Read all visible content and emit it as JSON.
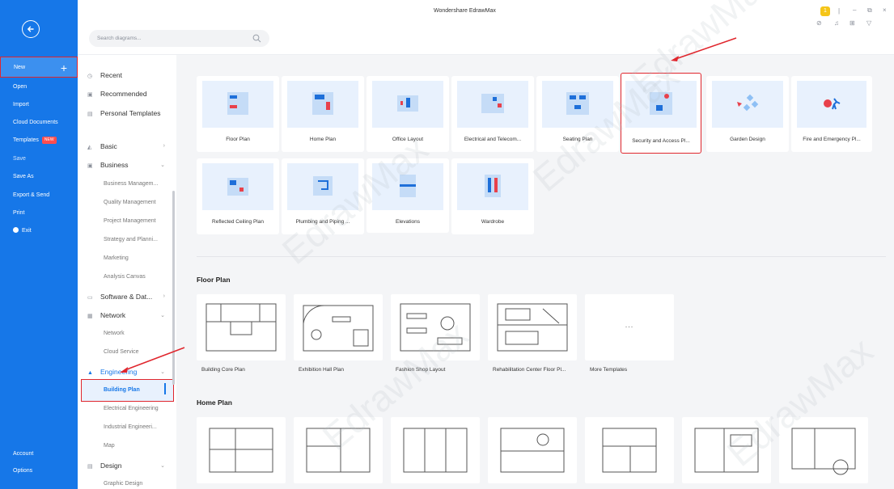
{
  "app": {
    "title": "Wondershare EdrawMax",
    "user_badge": "1"
  },
  "search": {
    "placeholder": "Search diagrams..."
  },
  "leftnav": {
    "new": "New",
    "open": "Open",
    "import": "Import",
    "cloud_documents": "Cloud Documents",
    "templates": "Templates",
    "templates_badge": "NEW",
    "save": "Save",
    "save_as": "Save As",
    "export_send": "Export & Send",
    "print": "Print",
    "exit": "Exit",
    "account": "Account",
    "options": "Options"
  },
  "categories": {
    "recent": "Recent",
    "recommended": "Recommended",
    "personal_templates": "Personal Templates",
    "basic": "Basic",
    "business": "Business",
    "business_subs": [
      "Business Managem...",
      "Quality Management",
      "Project Management",
      "Strategy and Planni...",
      "Marketing",
      "Analysis Canvas"
    ],
    "software": "Software & Dat...",
    "network": "Network",
    "network_subs": [
      "Network",
      "Cloud Service"
    ],
    "engineering": "Engineering",
    "engineering_subs": [
      "Building Plan",
      "Electrical Engineering",
      "Industrial Engineeri...",
      "Map"
    ],
    "design": "Design",
    "design_subs": [
      "Graphic Design"
    ]
  },
  "tiles": [
    "Floor Plan",
    "Home Plan",
    "Office Layout",
    "Electrical and Telecom...",
    "Seating Plan",
    "Security and Access Pl...",
    "Garden Design",
    "Fire and Emergency Pl...",
    "Reflected Ceiling Plan",
    "Plumbing and Piping ...",
    "Elevations",
    "Wardrobe"
  ],
  "floor_plan_section": {
    "title": "Floor Plan",
    "templates": [
      "Building Core Plan",
      "Exhibition Hall Plan",
      "Fashion Shop Layout",
      "Rehabilitation Center Floor Pl...",
      "More Templates"
    ],
    "more_dots": "..."
  },
  "home_plan_section": {
    "title": "Home Plan"
  },
  "watermark": "EdrawMax",
  "colors": {
    "brand_blue": "#1677e8",
    "highlight_red": "#e0262d",
    "thumb_bg": "#e8f1fd"
  }
}
